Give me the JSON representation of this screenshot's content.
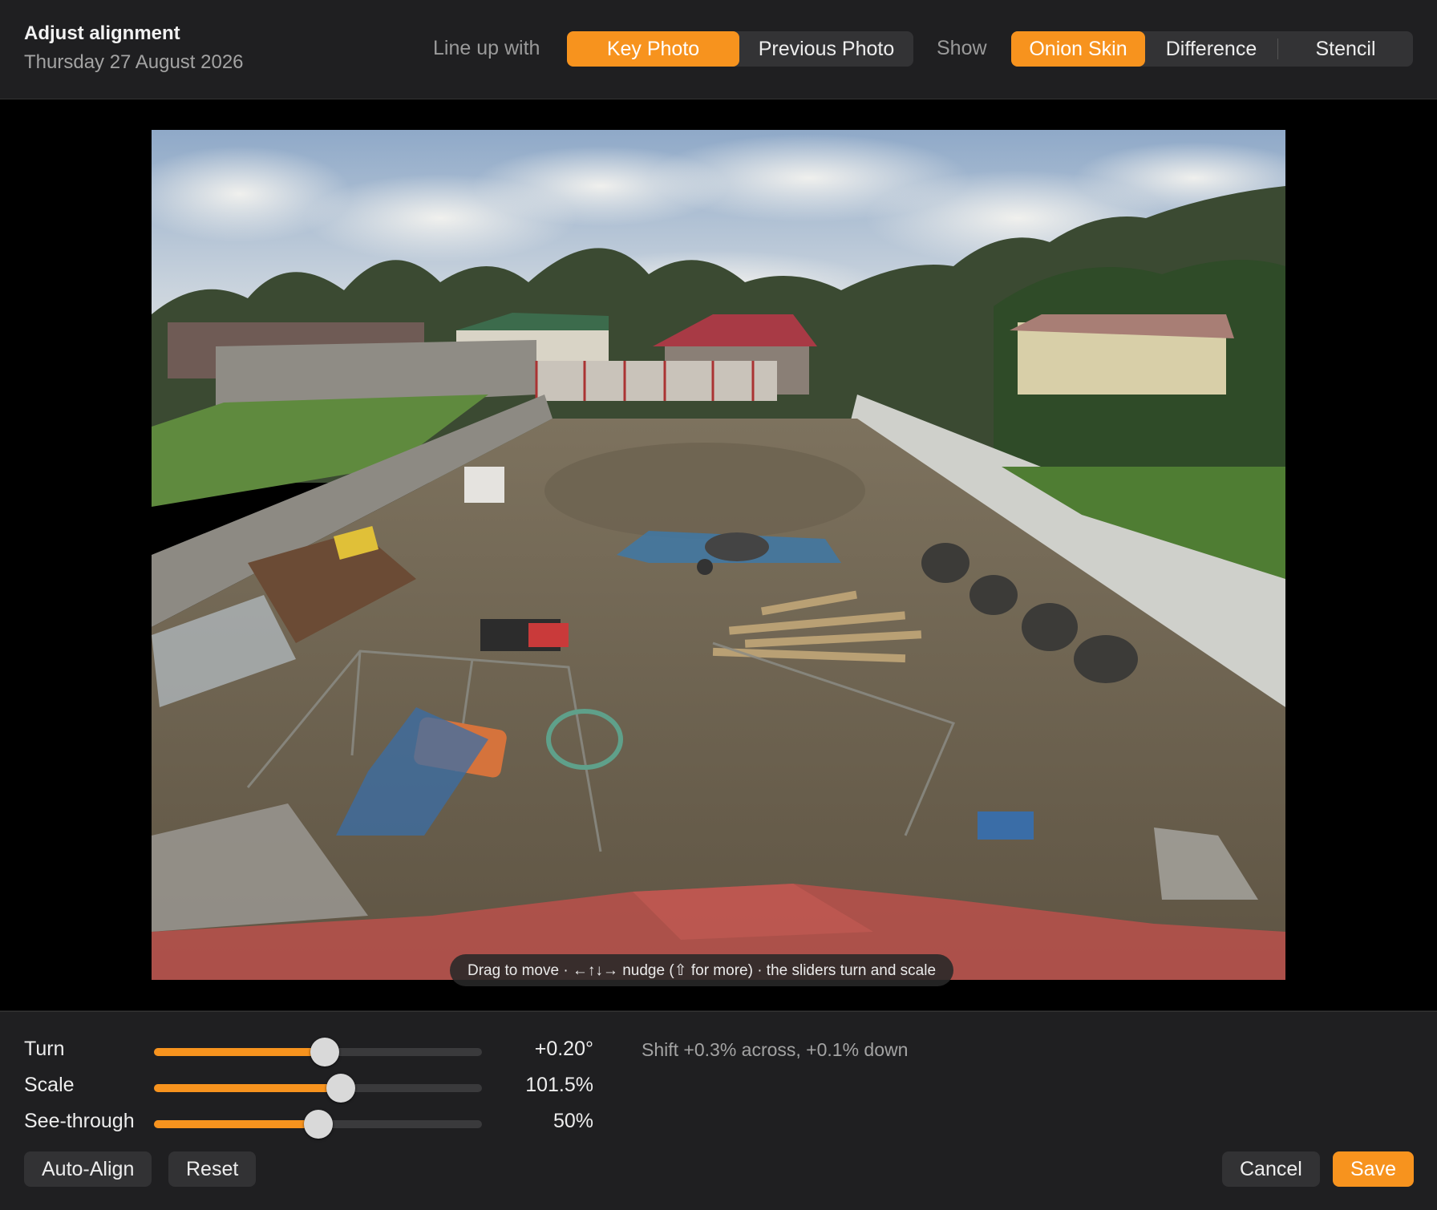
{
  "header": {
    "title": "Adjust alignment",
    "date": "Thursday 27 August 2026",
    "lineup_label": "Line up with",
    "lineup_options": [
      "Key Photo",
      "Previous Photo"
    ],
    "lineup_selected": "Key Photo",
    "show_label": "Show",
    "show_options": [
      "Onion Skin",
      "Difference",
      "Stencil"
    ],
    "show_selected": "Onion Skin"
  },
  "canvas": {
    "hint": "Drag to move · ←↑↓→ nudge (⇧ for more) · the sliders turn and scale"
  },
  "controls": {
    "turn": {
      "label": "Turn",
      "value_text": "+0.20°",
      "level": 0.52
    },
    "scale": {
      "label": "Scale",
      "value_text": "101.5%",
      "level": 0.57
    },
    "see_through": {
      "label": "See-through",
      "value_text": "50%",
      "level": 0.5
    },
    "shift_text": "Shift +0.3% across, +0.1% down",
    "buttons": {
      "auto_align": "Auto-Align",
      "reset": "Reset",
      "cancel": "Cancel",
      "save": "Save"
    }
  },
  "colors": {
    "accent": "#f7931e",
    "background": "#1c1c1e",
    "canvas": "#000000"
  }
}
